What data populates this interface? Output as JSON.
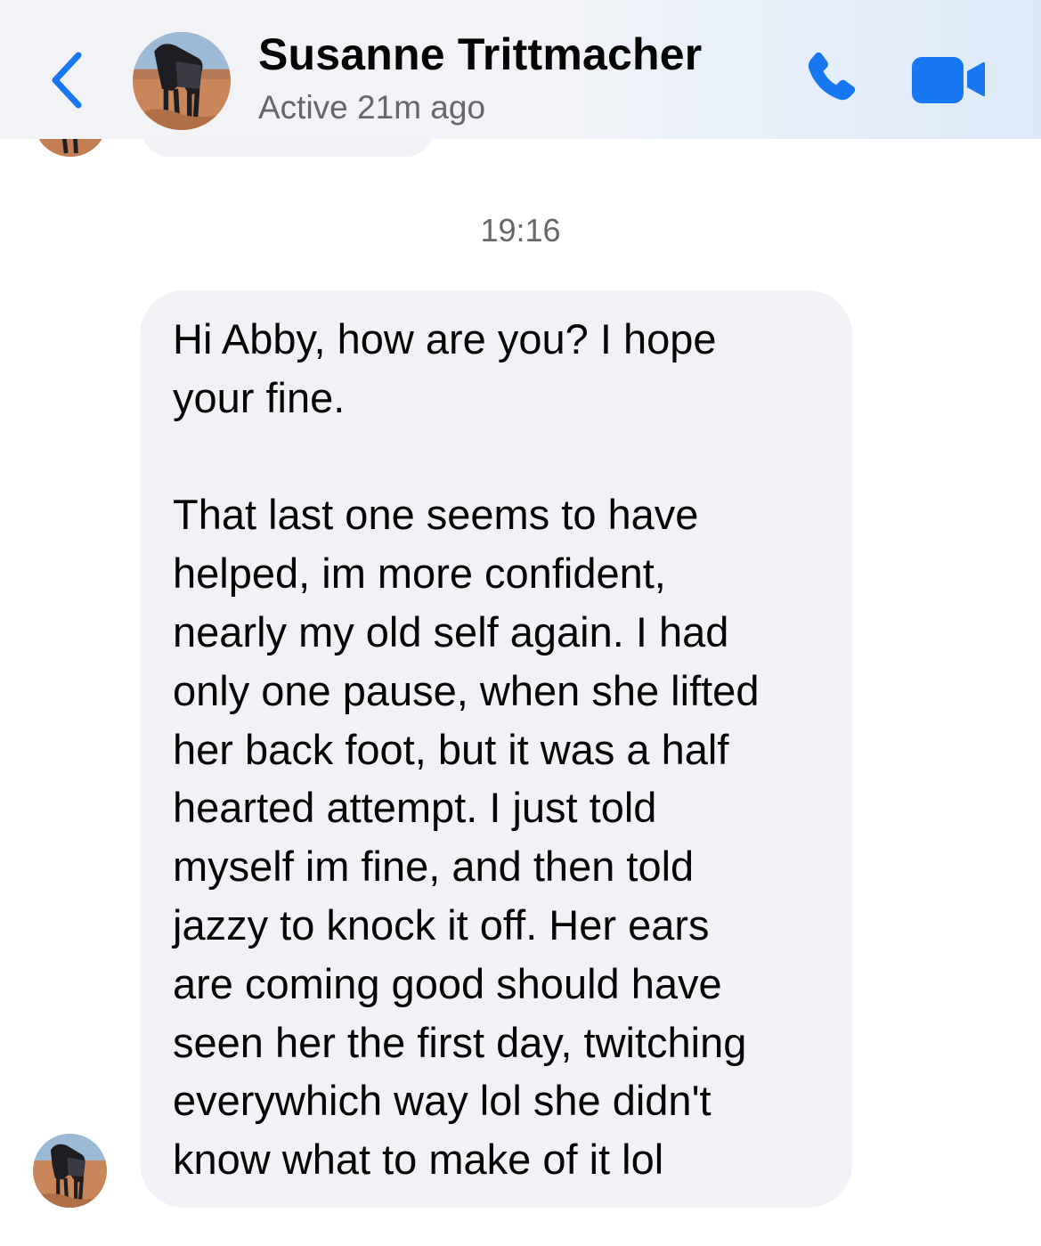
{
  "header": {
    "back_icon": "chevron-left-icon",
    "contact_name": "Susanne Trittmacher",
    "status": "Active 21m ago",
    "call_icon": "phone-icon",
    "video_icon": "video-camera-icon",
    "accent_color": "#1877f2"
  },
  "thread": {
    "timestamp": "19:16",
    "message": {
      "lines": [
        "Hi Abby, how are you?  I hope",
        "your fine.",
        "",
        "That last one seems to have",
        "helped, im more confident,",
        "nearly my old self again.  I had",
        "only one pause, when she lifted",
        "her back foot, but it was a half",
        "hearted attempt.  I just told",
        "myself im fine, and then told",
        "jazzy to knock it off.  Her ears",
        "are coming good should have",
        "seen her the first day, twitching",
        "everywhich way lol she didn't",
        "know what to make of it lol"
      ]
    }
  }
}
